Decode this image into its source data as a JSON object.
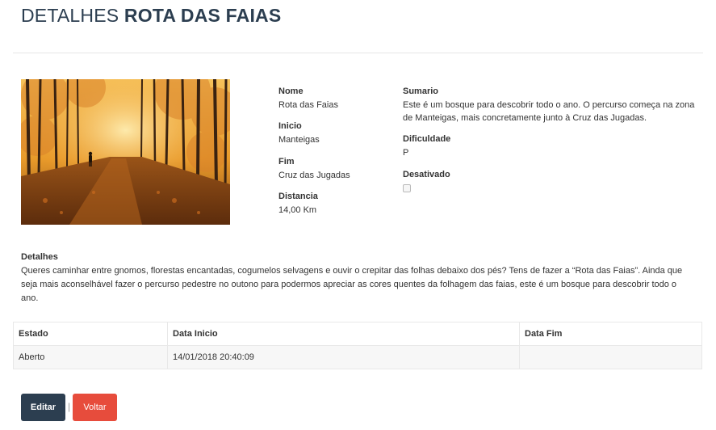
{
  "page": {
    "title_prefix": "DETALHES",
    "title_name": "ROTA DAS FAIAS"
  },
  "fields": {
    "nome": {
      "label": "Nome",
      "value": "Rota das Faias"
    },
    "inicio": {
      "label": "Inicio",
      "value": "Manteigas"
    },
    "fim": {
      "label": "Fim",
      "value": "Cruz das Jugadas"
    },
    "distancia": {
      "label": "Distancia",
      "value": "14,00 Km"
    },
    "sumario": {
      "label": "Sumario",
      "value": "Este é um bosque para descobrir todo o ano. O percurso começa na zona de Manteigas,  mais concretamente junto à Cruz das Jugadas."
    },
    "dificuldade": {
      "label": "Dificuldade",
      "value": "P"
    },
    "desativado": {
      "label": "Desativado",
      "checked": false
    }
  },
  "details": {
    "label": "Detalhes",
    "text": " Queres caminhar entre gnomos, florestas encantadas, cogumelos selvagens e ouvir o  crepitar das folhas debaixo dos pés? Tens de fazer a “Rota das Faias”.  Ainda que seja mais aconselhável fazer o percurso pedestre no outono para  podermos apreciar as cores quentes da folhagem das faias, este é um bosque para  descobrir todo o ano."
  },
  "history_table": {
    "headers": [
      "Estado",
      "Data Inicio",
      "Data Fim"
    ],
    "rows": [
      [
        "Aberto",
        "14/01/2018 20:40:09",
        ""
      ]
    ]
  },
  "buttons": {
    "edit": "Editar",
    "separator": "|",
    "back": "Voltar"
  },
  "colors": {
    "title": "#2c3e50",
    "edit_button": "#2c3e50",
    "back_button": "#e74c3c"
  }
}
